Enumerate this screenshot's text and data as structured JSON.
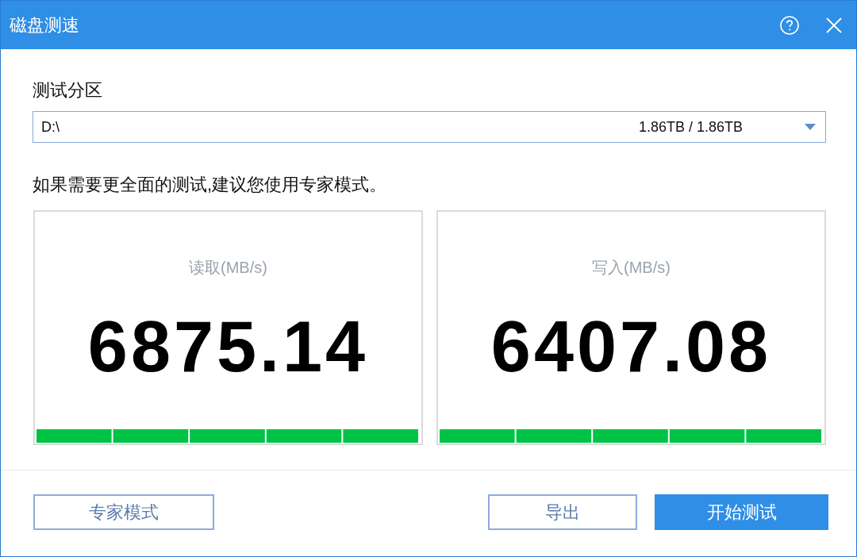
{
  "window": {
    "title": "磁盘测速"
  },
  "partition": {
    "label": "测试分区",
    "value": "D:\\",
    "capacity": "1.86TB / 1.86TB"
  },
  "hint": "如果需要更全面的测试,建议您使用专家模式。",
  "meters": [
    {
      "label": "读取(MB/s)",
      "reading": "6875.14",
      "level": 1
    },
    {
      "label": "写入(MB/s)",
      "reading": "6407.08",
      "level": 1
    }
  ],
  "buttons": [
    {
      "label": "专家模式",
      "kind": "outline"
    },
    {
      "label": "导出",
      "kind": "outline"
    },
    {
      "label": "开始测试",
      "kind": "primary"
    }
  ]
}
